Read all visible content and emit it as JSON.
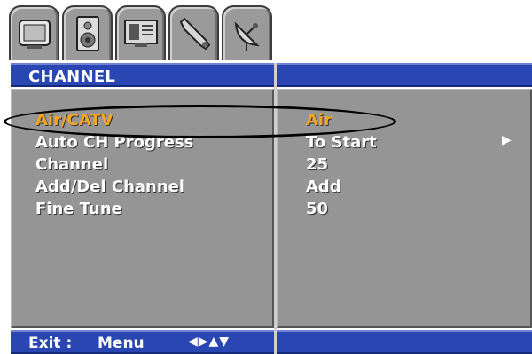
{
  "header": {
    "title": "CHANNEL"
  },
  "tabs": [
    {
      "icon": "tv-icon"
    },
    {
      "icon": "speaker-icon"
    },
    {
      "icon": "display-grid-icon"
    },
    {
      "icon": "wrench-icon"
    },
    {
      "icon": "satellite-dish-icon"
    }
  ],
  "menu": {
    "items": [
      {
        "label": "Air/CATV",
        "value": "Air"
      },
      {
        "label": "Auto CH Progress",
        "value": "To Start"
      },
      {
        "label": "Channel",
        "value": "25"
      },
      {
        "label": "Add/Del Channel",
        "value": "Add"
      },
      {
        "label": "Fine Tune",
        "value": "50"
      }
    ]
  },
  "footer": {
    "exit_label": "Exit :",
    "exit_key": "Menu",
    "nav_arrows": "◀▶▲▼"
  },
  "colors": {
    "bar": "#2a46b2",
    "panel": "#959595",
    "active_text": "#f5a623"
  }
}
